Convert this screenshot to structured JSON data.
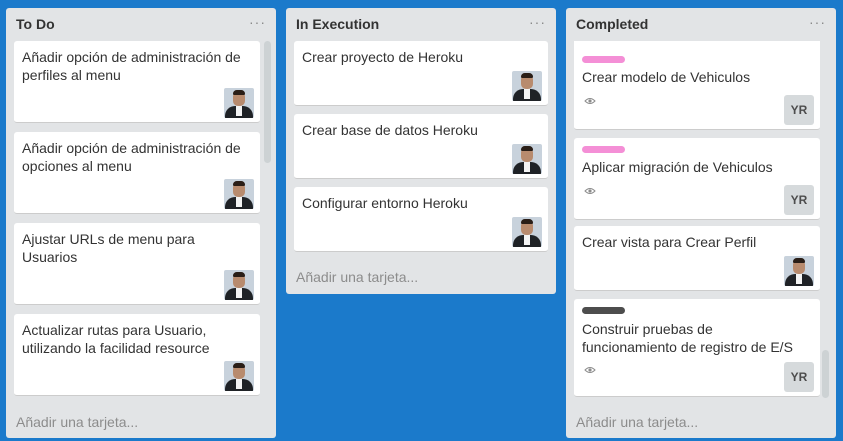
{
  "lists": [
    {
      "title": "To Do",
      "menu_icon": "ellipsis-icon",
      "cards": [
        {
          "title": "Añadir opción de administración de perfiles al menu"
        },
        {
          "title": "Añadir opción de administración de opciones al menu"
        },
        {
          "title": "Ajustar URLs de menu para Usuarios"
        },
        {
          "title": "Actualizar rutas para Usuario, utilizando la facilidad resource"
        }
      ],
      "add_card": "Añadir una tarjeta..."
    },
    {
      "title": "In Execution",
      "menu_icon": "ellipsis-icon",
      "cards": [
        {
          "title": "Crear proyecto de Heroku"
        },
        {
          "title": "Crear base de datos Heroku"
        },
        {
          "title": "Configurar entorno Heroku"
        }
      ],
      "add_card": "Añadir una tarjeta..."
    },
    {
      "title": "Completed",
      "menu_icon": "ellipsis-icon",
      "cards": [
        {
          "title": "Crear modelo de Vehiculos",
          "label_color": "#f48fd6",
          "member": "YR"
        },
        {
          "title": "Aplicar migración de Vehiculos",
          "label_color": "#f48fd6",
          "member": "YR"
        },
        {
          "title": "Crear vista para Crear Perfil"
        },
        {
          "title": "Construir pruebas de funcionamiento de registro de E/S",
          "label_color": "#4d4d4d",
          "member": "YR"
        }
      ],
      "add_card": "Añadir una tarjeta..."
    }
  ],
  "colors": {
    "board_background": "#1b7acb",
    "list_background": "#e2e4e6"
  }
}
